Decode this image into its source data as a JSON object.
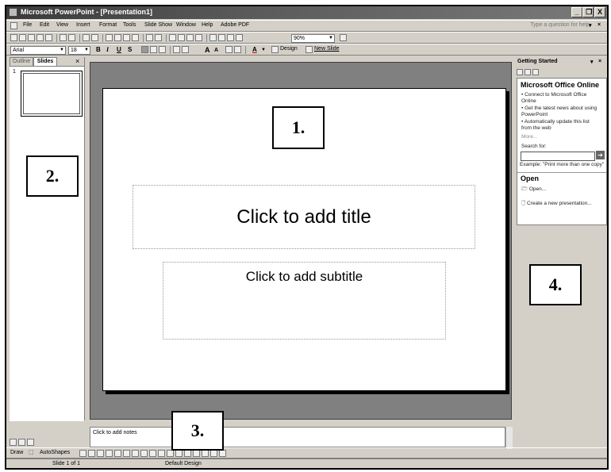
{
  "window": {
    "title": "Microsoft PowerPoint - [Presentation1]",
    "min": "_",
    "max": " ❐",
    "close": "X"
  },
  "menubar": {
    "items": [
      "File",
      "Edit",
      "View",
      "Insert",
      "Format",
      "Tools",
      "Slide Show",
      "Window",
      "Help",
      "Adobe PDF"
    ],
    "ask_placeholder": "Type a question for help"
  },
  "standard_toolbar": {
    "zoom": "90%"
  },
  "format_toolbar": {
    "font": "Arial",
    "size": "18",
    "bold": "B",
    "italic": "I",
    "underline": "U",
    "shadow": "S",
    "grow": "A",
    "shrink": "A",
    "design_label": "Design",
    "new_slide_label": "New Slide"
  },
  "left_pane": {
    "tabs": [
      "Outline",
      "Slides"
    ],
    "close": "×",
    "slide_number": "1"
  },
  "slide": {
    "title_placeholder": "Click to add title",
    "subtitle_placeholder": "Click to add subtitle"
  },
  "notes": {
    "placeholder": "Click to add notes"
  },
  "task_pane": {
    "header": "Getting Started",
    "section1": "Microsoft Office Online",
    "bullets": [
      "Connect to Microsoft Office Online",
      "Get the latest news about using PowerPoint",
      "Automatically update this list from the web"
    ],
    "more": "More...",
    "search_label": "Search for:",
    "example": "Example: \"Print more than one copy\"",
    "section2": "Open",
    "open_link": "Open...",
    "create_link": "Create a new presentation..."
  },
  "callouts": {
    "c1": "1.",
    "c2": "2.",
    "c3": "3.",
    "c4": "4."
  },
  "draw_toolbar": {
    "draw": "Draw",
    "autoshapes": "AutoShapes"
  },
  "status": {
    "slide": "Slide 1 of 1",
    "design": "Default Design"
  }
}
